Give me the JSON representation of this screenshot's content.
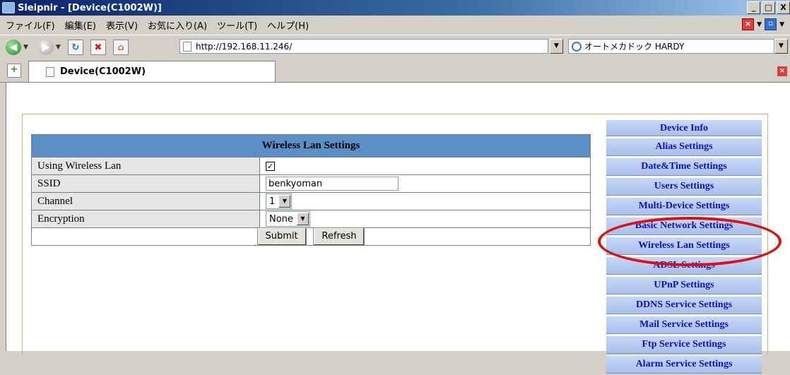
{
  "window": {
    "title": "Sleipnir - [Device(C1002W)]",
    "min": "_",
    "max": "□",
    "close": "X"
  },
  "menu": {
    "items": [
      "ファイル(F)",
      "編集(E)",
      "表示(V)",
      "お気に入り(A)",
      "ツール(T)",
      "ヘルプ(H)"
    ]
  },
  "nav": {
    "address": "http://192.168.11.246/",
    "search": "オートメカドック HARDY"
  },
  "tab": {
    "label": "Device(C1002W)"
  },
  "form": {
    "header": "Wireless Lan Settings",
    "rows": {
      "wireless": {
        "label": "Using Wireless Lan",
        "checked": "✓"
      },
      "ssid": {
        "label": "SSID",
        "value": "benkyoman"
      },
      "channel": {
        "label": "Channel",
        "value": "1"
      },
      "encryption": {
        "label": "Encryption",
        "value": "None"
      }
    },
    "submit": "Submit",
    "refresh": "Refresh"
  },
  "sidenav": {
    "items": [
      "Device Info",
      "Alias Settings",
      "Date&Time Settings",
      "Users Settings",
      "Multi-Device Settings",
      "Basic Network Settings",
      "Wireless Lan Settings",
      "ADSL Settings",
      "UPnP Settings",
      "DDNS Service Settings",
      "Mail Service Settings",
      "Ftp Service Settings",
      "Alarm Service Settings"
    ]
  },
  "colors": {
    "annotation": "#e01010",
    "table_header": "#5a8fc8",
    "nav_text": "#1010c0"
  }
}
